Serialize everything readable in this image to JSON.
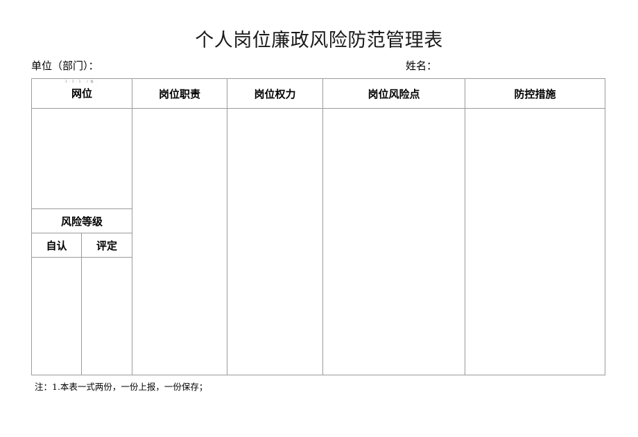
{
  "document": {
    "title": "个人岗位廉政风险防范管理表"
  },
  "meta": {
    "unit_label": "单位（部门）：",
    "unit_value": "",
    "name_label": "姓名：",
    "name_value": ""
  },
  "table": {
    "headers": {
      "post": "网位",
      "post_tiny": "1·1·1    ノ咀.",
      "duty": "岗位职责",
      "power": "岗位权力",
      "risk_point": "岗位风险点",
      "control_measure": "防控措施"
    },
    "risk_grade": {
      "label": "风险等级",
      "self_assess": "自认",
      "evaluated": "评定"
    },
    "cells": {
      "post_blank": "",
      "self_assess_blank": "",
      "evaluated_blank": "",
      "duty_blank": "",
      "power_blank": "",
      "risk_point_blank": "",
      "control_measure_blank": ""
    }
  },
  "footer": {
    "note": "注：1.本表一式两份，一份上报，一份保存；"
  },
  "colors": {
    "border": "#9a9a9a",
    "text": "#000000",
    "title": "#1a1a1a",
    "background": "#ffffff"
  }
}
